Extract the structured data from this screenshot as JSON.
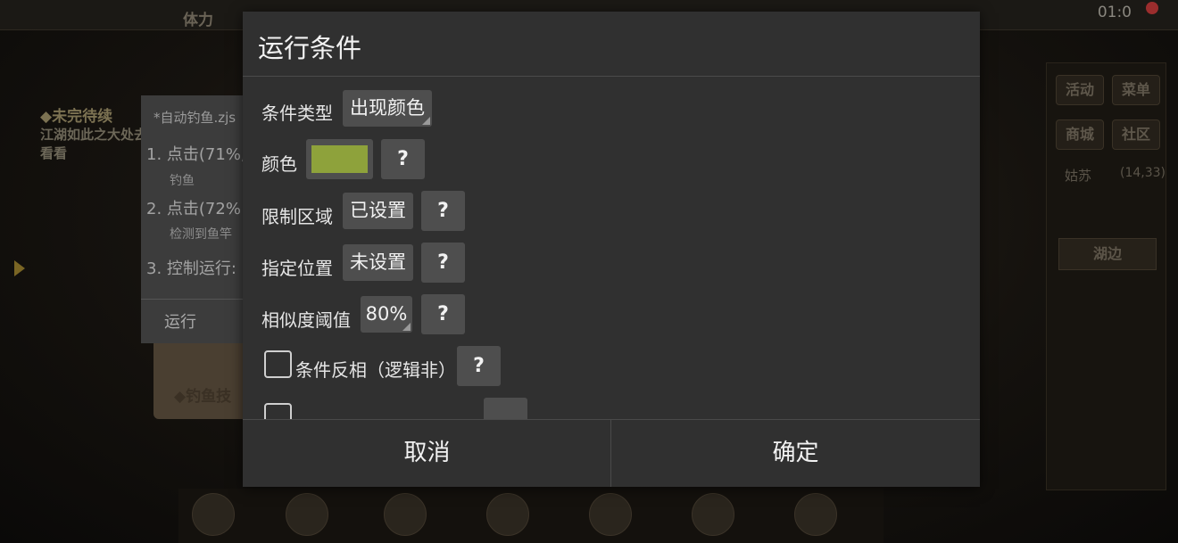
{
  "background": {
    "top_tab": "体力",
    "clock": "01:0",
    "quest_title": "◆未完待续",
    "quest_text": "江湖如此之大处去看看",
    "scroll_text": "◆钓鱼技",
    "right_buttons": [
      "活动",
      "菜单",
      "商城",
      "社区"
    ],
    "location": "姑苏",
    "location_coords": "(14,33)",
    "lake_label": "湖边",
    "script_panel": {
      "title": "*自动钓鱼.zjs",
      "line1": "1. 点击(71%,",
      "line1_sub": "钓鱼",
      "line2": "2. 点击(72%",
      "line2_sub": "检测到鱼竿",
      "line3": "3. 控制运行:",
      "run_label": "运行"
    }
  },
  "dialog": {
    "title": "运行条件",
    "condition_type": {
      "label": "条件类型",
      "value": "出现颜色"
    },
    "color": {
      "label": "颜色",
      "swatch": "#8ea23b",
      "help": "?"
    },
    "limit_region": {
      "label": "限制区域",
      "value": "已设置",
      "help": "?"
    },
    "position": {
      "label": "指定位置",
      "value": "未设置",
      "help": "?"
    },
    "threshold": {
      "label": "相似度阈值",
      "value": "80%",
      "help": "?"
    },
    "invert": {
      "label": "条件反相（逻辑非）",
      "checked": false,
      "help": "?"
    },
    "cancel_label": "取消",
    "confirm_label": "确定"
  }
}
